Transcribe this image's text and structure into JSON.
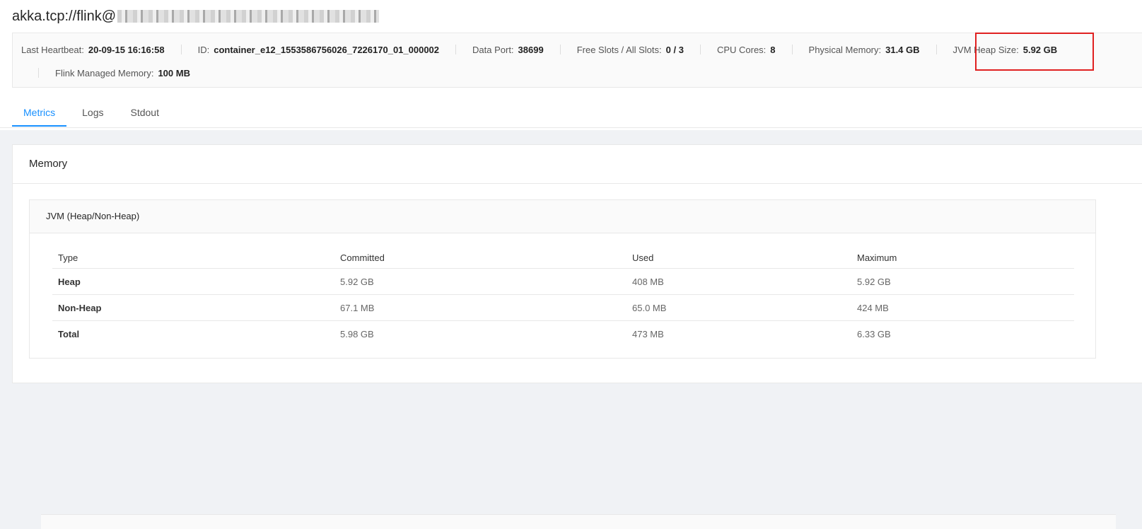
{
  "header": {
    "title_prefix": "akka.tcp://flink@"
  },
  "info": {
    "last_heartbeat": {
      "label": "Last Heartbeat:",
      "value": "20-09-15 16:16:58"
    },
    "id": {
      "label": "ID:",
      "value": "container_e12_1553586756026_7226170_01_000002"
    },
    "data_port": {
      "label": "Data Port:",
      "value": "38699"
    },
    "free_slots": {
      "label": "Free Slots / All Slots:",
      "value": "0 / 3"
    },
    "cpu_cores": {
      "label": "CPU Cores:",
      "value": "8"
    },
    "physical_memory": {
      "label": "Physical Memory:",
      "value": "31.4 GB"
    },
    "jvm_heap": {
      "label": "JVM Heap Size:",
      "value": "5.92 GB"
    },
    "managed_memory": {
      "label": "Flink Managed Memory:",
      "value": "100 MB"
    }
  },
  "tabs": [
    {
      "label": "Metrics",
      "active": true
    },
    {
      "label": "Logs",
      "active": false
    },
    {
      "label": "Stdout",
      "active": false
    }
  ],
  "memory": {
    "title": "Memory",
    "jvm": {
      "title": "JVM (Heap/Non-Heap)",
      "columns": [
        "Type",
        "Committed",
        "Used",
        "Maximum"
      ],
      "rows": [
        [
          "Heap",
          "5.92 GB",
          "408 MB",
          "5.92 GB"
        ],
        [
          "Non-Heap",
          "67.1 MB",
          "65.0 MB",
          "424 MB"
        ],
        [
          "Total",
          "5.98 GB",
          "473 MB",
          "6.33 GB"
        ]
      ]
    }
  },
  "colors": {
    "accent": "#1890ff",
    "highlight": "#e02020"
  }
}
